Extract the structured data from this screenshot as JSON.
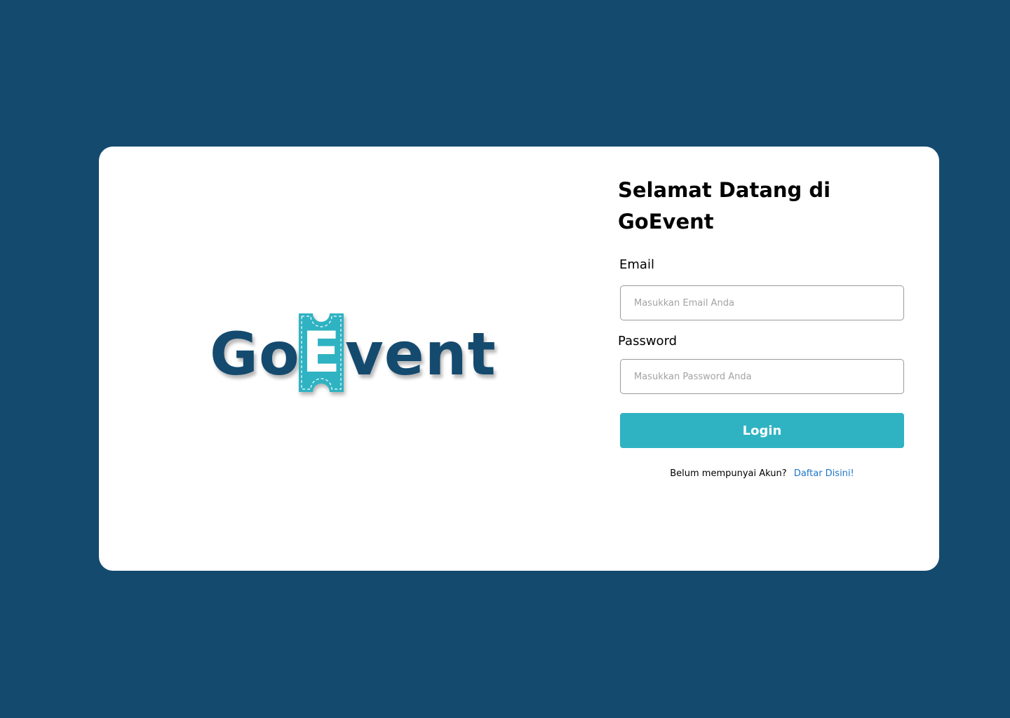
{
  "brand": {
    "logo": {
      "part_start": "Go",
      "ticket_letter": "E",
      "part_end": "vent"
    },
    "colors": {
      "background": "#144a6e",
      "card": "#ffffff",
      "logo_text": "#144a6e",
      "ticket": "#2fb3c2",
      "button": "#2fb3c2",
      "link": "#1f77c9"
    }
  },
  "login_form": {
    "title": "Selamat Datang di GoEvent",
    "email": {
      "label": "Email",
      "value": "",
      "placeholder": "Masukkan Email Anda"
    },
    "password": {
      "label": "Password",
      "value": "",
      "placeholder": "Masukkan Password Anda"
    },
    "submit_label": "Login",
    "register_prompt": "Belum mempunyai Akun?",
    "register_link": "Daftar Disini!"
  }
}
